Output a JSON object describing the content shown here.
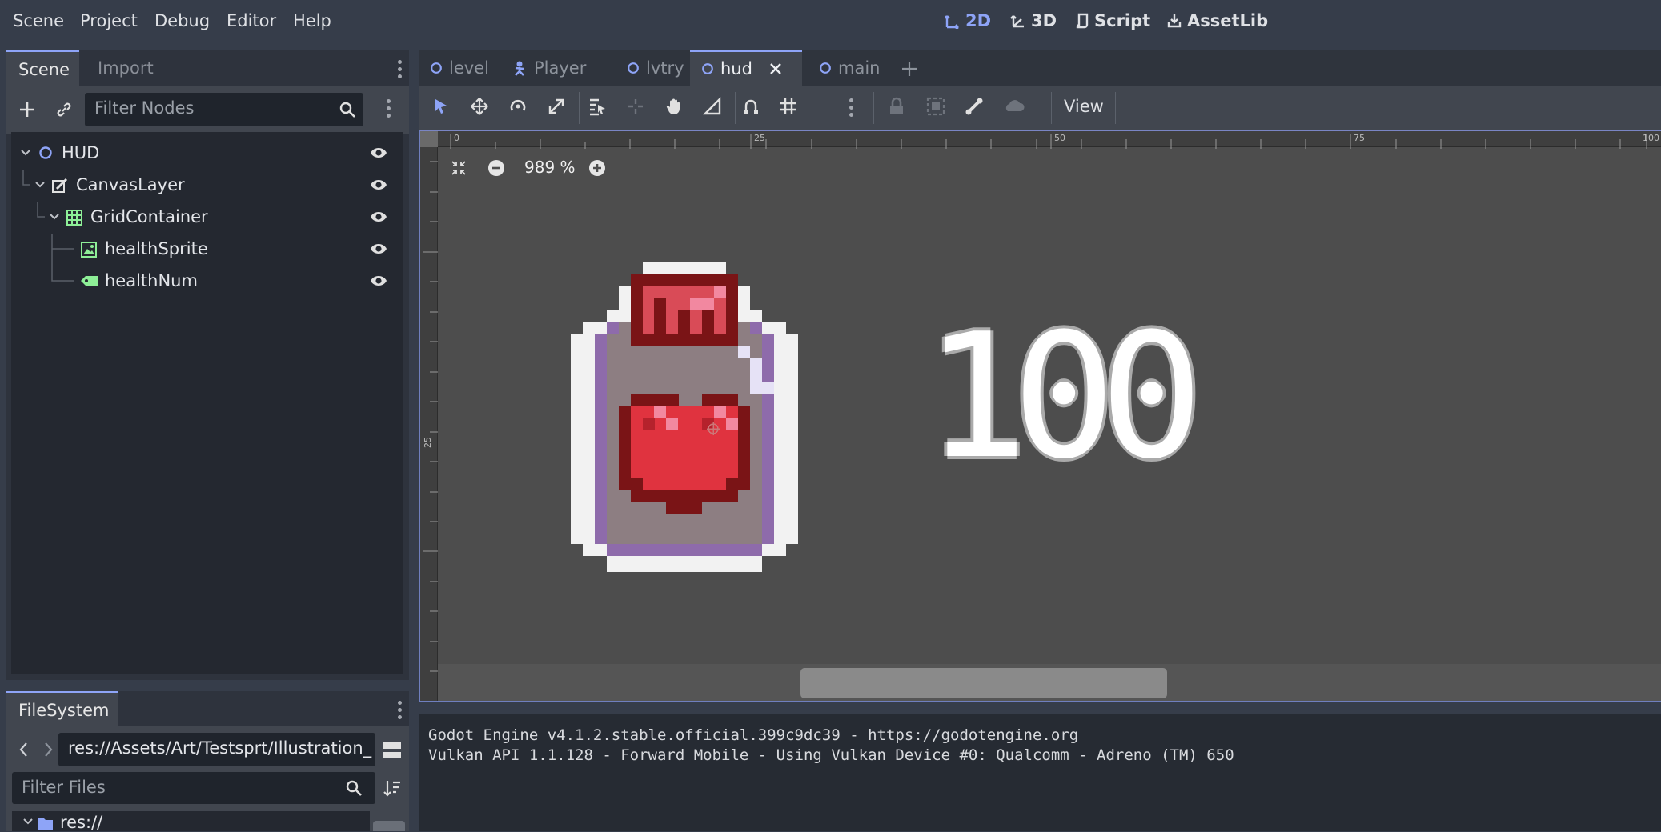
{
  "menu": [
    "Scene",
    "Project",
    "Debug",
    "Editor",
    "Help"
  ],
  "modes": [
    {
      "label": "2D",
      "icon": "2d-icon",
      "active": true
    },
    {
      "label": "3D",
      "icon": "3d-icon",
      "active": false
    },
    {
      "label": "Script",
      "icon": "script-icon",
      "active": false
    },
    {
      "label": "AssetLib",
      "icon": "assetlib-icon",
      "active": false
    }
  ],
  "scene_dock": {
    "tabs": [
      "Scene",
      "Import"
    ],
    "filter_placeholder": "Filter Nodes",
    "tree": [
      {
        "label": "HUD",
        "icon": "node-circle-icon",
        "depth": 0
      },
      {
        "label": "CanvasLayer",
        "icon": "canvas-layer-icon",
        "depth": 1
      },
      {
        "label": "GridContainer",
        "icon": "grid-container-icon",
        "depth": 2
      },
      {
        "label": "healthSprite",
        "icon": "texture-rect-icon",
        "depth": 3
      },
      {
        "label": "healthNum",
        "icon": "label-node-icon",
        "depth": 3
      }
    ]
  },
  "filesystem": {
    "tab": "FileSystem",
    "path": "res://Assets/Art/Testsprt/Illustration_",
    "filter_placeholder": "Filter Files",
    "root_item": "res://"
  },
  "editor_tabs": [
    {
      "label": "level",
      "icon": "node-circle-icon",
      "active": false
    },
    {
      "label": "Player",
      "icon": "character-icon",
      "active": false
    },
    {
      "label": "lvtry",
      "icon": "node-circle-icon",
      "active": false
    },
    {
      "label": "hud",
      "icon": "node-circle-icon",
      "active": true
    },
    {
      "label": "main",
      "icon": "node-circle-icon",
      "active": false
    }
  ],
  "toolbar": {
    "view_label": "View"
  },
  "viewport": {
    "zoom": "989 %",
    "ruler_top": [
      "0",
      "25",
      "50",
      "75",
      "100"
    ],
    "ruler_left": [
      "25"
    ],
    "hud_number": "100"
  },
  "output": [
    "Godot Engine v4.1.2.stable.official.399c9dc39 - https://godotengine.org",
    "Vulkan API 1.1.128 - Forward Mobile - Using Vulkan Device #0: Qualcomm - Adreno (TM) 650"
  ],
  "colors": {
    "accent": "#8ea4f7",
    "node_green": "#8eef97",
    "heart_red": "#e0333f",
    "bottle_purple": "#8e6bab"
  }
}
